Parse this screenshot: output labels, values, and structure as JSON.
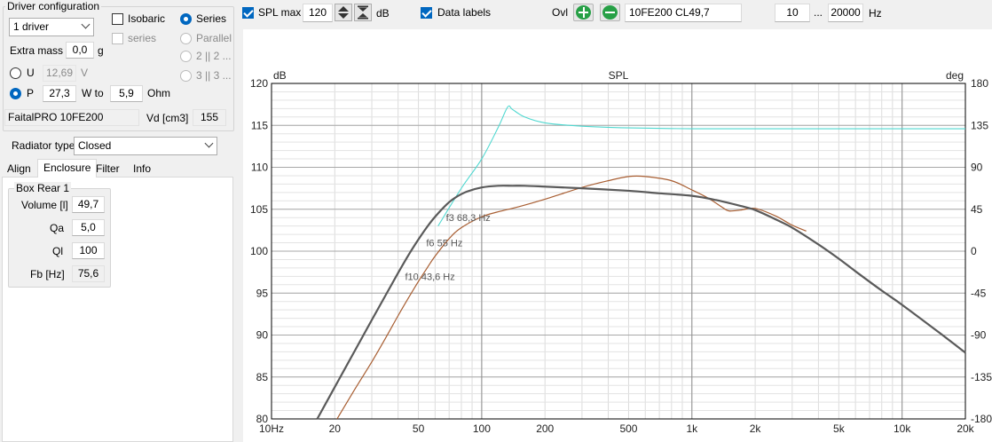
{
  "driver_config": {
    "title": "Driver configuration",
    "drivers_select": "1 driver",
    "isobaric_label": "Isobaric",
    "series_check_label": "series",
    "extra_mass_label": "Extra mass",
    "extra_mass_value": "0,0",
    "extra_mass_unit": "g",
    "wiring": {
      "series": "Series",
      "parallel": "Parallel",
      "two_two": "2 || 2 ...",
      "three_three": "3 || 3 ..."
    },
    "u_label": "U",
    "u_value": "12,69",
    "u_unit": "V",
    "p_label": "P",
    "p_value": "27,3",
    "w_to_label": "W to",
    "ohm_value": "5,9",
    "ohm_unit": "Ohm",
    "driver_name": "FaitalPRO 10FE200",
    "vd_label": "Vd [cm3]",
    "vd_value": "155"
  },
  "radiator": {
    "label": "Radiator type",
    "value": "Closed"
  },
  "tabs": [
    "Align",
    "Enclosure",
    "Filter",
    "Info"
  ],
  "box": {
    "title": "Box Rear 1",
    "fields": [
      {
        "label": "Volume [l]",
        "value": "49,7"
      },
      {
        "label": "Qa",
        "value": "5,0"
      },
      {
        "label": "Ql",
        "value": "100"
      },
      {
        "label": "Fb [Hz]",
        "value": "75,6"
      }
    ]
  },
  "toolbar": {
    "spl_max_label": "SPL max",
    "spl_max_value": "120",
    "db_unit": "dB",
    "data_labels_label": "Data labels",
    "ovl_label": "Ovl",
    "overlay_name": "10FE200 CL49,7",
    "freq_from": "10",
    "freq_sep": "...",
    "freq_to": "20000",
    "hz_unit": "Hz"
  },
  "colors": {
    "accent": "#0067c0",
    "main_curve": "#5a5a5a",
    "max_curve": "#4fd8d0",
    "overlay_curve": "#a85e32",
    "icon_green": "#27a046"
  },
  "chart_data": {
    "type": "line",
    "title": "SPL",
    "ylabel": "dB",
    "y2label": "deg",
    "x_scale": "log",
    "xlim": [
      10,
      20000
    ],
    "ylim": [
      80,
      120
    ],
    "y2lim": [
      -180,
      180
    ],
    "x_ticks": [
      10,
      20,
      50,
      100,
      200,
      500,
      1000,
      2000,
      5000,
      10000,
      20000
    ],
    "x_tick_labels": [
      "10Hz",
      "20",
      "50",
      "100",
      "200",
      "500",
      "1k",
      "2k",
      "5k",
      "10k",
      "20k"
    ],
    "y_ticks": [
      80,
      85,
      90,
      95,
      100,
      105,
      110,
      115,
      120
    ],
    "y2_ticks": [
      -180,
      -135,
      -90,
      -45,
      0,
      45,
      90,
      135,
      180
    ],
    "grid": true,
    "annotations": [
      {
        "text": "f3 68,3 Hz",
        "x": 68.3,
        "y": 104
      },
      {
        "text": "f6 55 Hz",
        "x": 55,
        "y": 101
      },
      {
        "text": "f10 43,6 Hz",
        "x": 43.6,
        "y": 97
      }
    ],
    "series": [
      {
        "id": "spl",
        "x": [
          16.5,
          20,
          25,
          30,
          35,
          40,
          45,
          50,
          55,
          60,
          68.3,
          75,
          85,
          100,
          120,
          140,
          160,
          200,
          300,
          500,
          700,
          1000,
          1300,
          1700,
          2000,
          2500,
          3000,
          4000,
          5000,
          6000,
          8000,
          10000,
          15000,
          20000
        ],
        "y": [
          80,
          83.8,
          88.2,
          91.8,
          94.8,
          97.4,
          99.6,
          101.4,
          102.9,
          104.1,
          105.6,
          106.4,
          107.1,
          107.6,
          107.8,
          107.8,
          107.8,
          107.7,
          107.5,
          107.2,
          106.9,
          106.6,
          106.1,
          105.4,
          104.9,
          103.8,
          102.8,
          100.8,
          99.1,
          97.6,
          95.3,
          93.6,
          90.3,
          87.9
        ]
      },
      {
        "id": "spl_max",
        "x": [
          62,
          80,
          100,
          120,
          133,
          140,
          160,
          200,
          300,
          500,
          1000,
          2000,
          5000,
          10000,
          20000
        ],
        "y": [
          103,
          107.5,
          111,
          114.8,
          117.2,
          116.9,
          116,
          115.3,
          114.9,
          114.7,
          114.6,
          114.6,
          114.6,
          114.6,
          114.6
        ]
      },
      {
        "id": "overlay",
        "x": [
          20.5,
          25,
          30,
          35,
          40,
          45,
          50,
          55,
          60,
          70,
          80,
          100,
          120,
          150,
          200,
          300,
          400,
          500,
          600,
          800,
          1000,
          1200,
          1400,
          1500,
          1700,
          2000,
          2500,
          3000,
          3500
        ],
        "y": [
          80,
          83.6,
          86.8,
          89.7,
          92.3,
          94.5,
          96.4,
          98,
          99.4,
          101.5,
          102.8,
          104.1,
          104.7,
          105.3,
          106.2,
          107.6,
          108.4,
          108.9,
          108.9,
          108.4,
          107.3,
          106.3,
          105.2,
          104.8,
          104.9,
          105.1,
          104.2,
          103.1,
          102.4
        ]
      }
    ]
  }
}
